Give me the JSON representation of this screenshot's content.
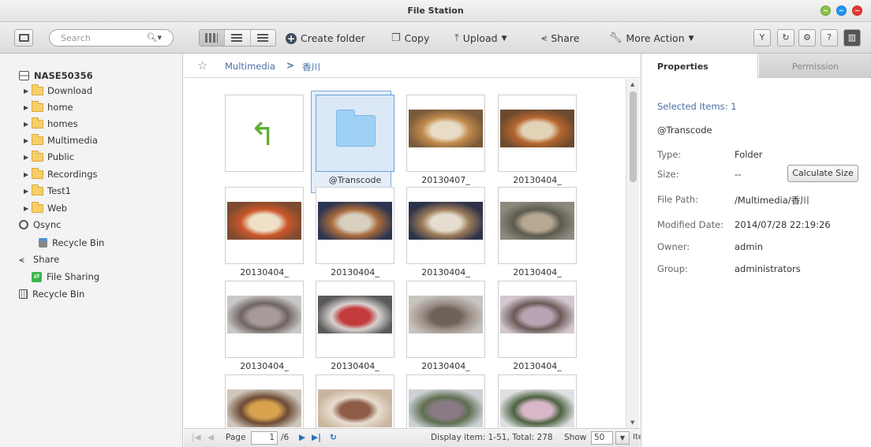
{
  "window": {
    "title": "File Station"
  },
  "toolbar": {
    "search_placeholder": "Search",
    "create_folder": "Create folder",
    "copy": "Copy",
    "upload": "Upload",
    "share": "Share",
    "more_action": "More Action"
  },
  "sidebar": {
    "nas_name": "NASE50356",
    "folders": [
      "Download",
      "home",
      "homes",
      "Multimedia",
      "Public",
      "Recordings",
      "Test1",
      "Web"
    ],
    "qsync": "Qsync",
    "qsync_recycle": "Recycle Bin",
    "share": "Share",
    "file_sharing": "File Sharing",
    "recycle_bin": "Recycle Bin"
  },
  "breadcrumb": {
    "root": "Multimedia",
    "current": "香川"
  },
  "tiles": [
    {
      "label": "",
      "kind": "back"
    },
    {
      "label": "@Transcode",
      "kind": "folder"
    },
    {
      "label": "20130407_",
      "kind": "photo",
      "colors": [
        "#7a5a3a",
        "#e8dcc6",
        "#c28a4c"
      ]
    },
    {
      "label": "20130404_",
      "kind": "photo",
      "colors": [
        "#6b4a2e",
        "#e2d3b6",
        "#b5652e"
      ]
    },
    {
      "label": "20130404_",
      "kind": "photo",
      "colors": [
        "#7c4b30",
        "#efe0c8",
        "#c9562a"
      ]
    },
    {
      "label": "20130404_",
      "kind": "photo",
      "colors": [
        "#2c3550",
        "#d8cfbf",
        "#a86a3c"
      ]
    },
    {
      "label": "20130404_",
      "kind": "photo",
      "colors": [
        "#2d3248",
        "#e5ded0",
        "#9c7c5a"
      ]
    },
    {
      "label": "20130404_",
      "kind": "photo",
      "colors": [
        "#8c8a7e",
        "#b6a892",
        "#5d5a4e"
      ]
    },
    {
      "label": "20130404_",
      "kind": "photo",
      "colors": [
        "#c9c8c8",
        "#a89a9a",
        "#6e6460"
      ]
    },
    {
      "label": "20130404_",
      "kind": "photo",
      "colors": [
        "#5a5a5a",
        "#c33b3b",
        "#d7d2d0"
      ]
    },
    {
      "label": "20130404_",
      "kind": "photo",
      "colors": [
        "#c8c4c0",
        "#6f6258",
        "#9b8f86"
      ]
    },
    {
      "label": "20130404_",
      "kind": "photo",
      "colors": [
        "#d3c8cf",
        "#b9a3b3",
        "#6a5a58"
      ]
    },
    {
      "label": "",
      "kind": "photo",
      "colors": [
        "#cfc7bb",
        "#d8a24e",
        "#6c4a35"
      ]
    },
    {
      "label": "",
      "kind": "photo",
      "colors": [
        "#c9b59d",
        "#8d5d47",
        "#e8ddd0"
      ]
    },
    {
      "label": "",
      "kind": "photo",
      "colors": [
        "#cdd1d6",
        "#8a7a86",
        "#5f6f50"
      ]
    },
    {
      "label": "",
      "kind": "photo",
      "colors": [
        "#dfe0e3",
        "#d8b8c8",
        "#4d6140"
      ]
    }
  ],
  "pager": {
    "page_label": "Page",
    "page_value": "1",
    "total_pages": "/6",
    "display": "Display item: 1-51, Total: 278",
    "show_label": "Show",
    "show_value": "50",
    "items_label": "Items"
  },
  "properties": {
    "tab_properties": "Properties",
    "tab_permission": "Permission",
    "selected_items": "Selected Items:  1",
    "name": "@Transcode",
    "type_label": "Type:",
    "type_value": "Folder",
    "size_label": "Size:",
    "size_value": "--",
    "calculate_size": "Calculate Size",
    "path_label": "File Path:",
    "path_value": "/Multimedia/香川",
    "modified_label": "Modified Date:",
    "modified_value": "2014/07/28 22:19:26",
    "owner_label": "Owner:",
    "owner_value": "admin",
    "group_label": "Group:",
    "group_value": "administrators"
  }
}
